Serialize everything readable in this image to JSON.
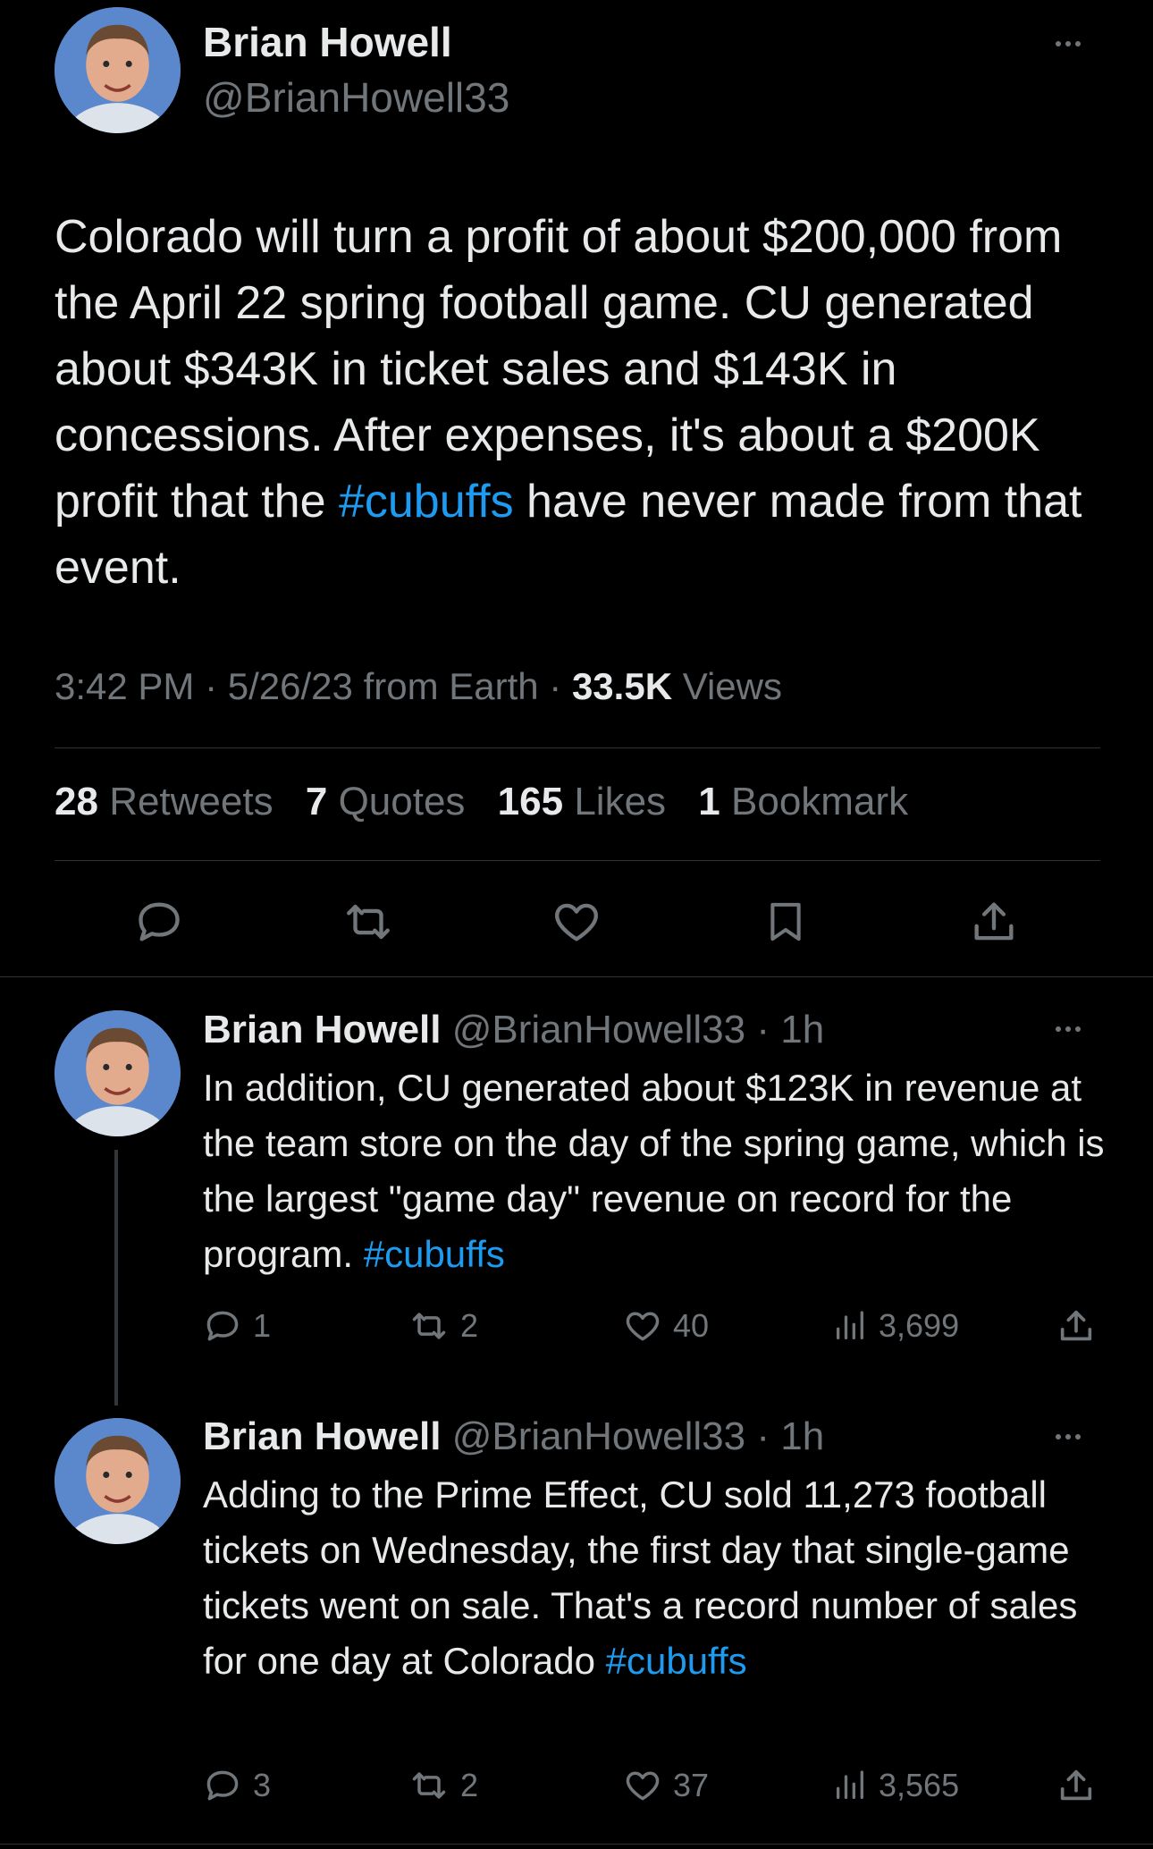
{
  "main_tweet": {
    "author_name": "Brian Howell",
    "author_handle": "@BrianHowell33",
    "text_before_tag": "Colorado will turn a profit of about $200,000 from the April 22 spring football game. CU generated about $343K in ticket sales and $143K in concessions. After expenses, it's about a $200K profit that the ",
    "hashtag": "#cubuffs",
    "text_after_tag": " have never made from that event.",
    "time": "3:42 PM",
    "date": "5/26/23",
    "source": "from Earth",
    "views_count": "33.5K",
    "views_label": "Views",
    "stats": {
      "retweets_count": "28",
      "retweets_label": "Retweets",
      "quotes_count": "7",
      "quotes_label": "Quotes",
      "likes_count": "165",
      "likes_label": "Likes",
      "bookmarks_count": "1",
      "bookmarks_label": "Bookmark"
    }
  },
  "replies": [
    {
      "author_name": "Brian Howell",
      "author_handle": "@BrianHowell33",
      "time_ago": "1h",
      "text_before_tag": "In addition, CU generated about $123K in revenue at the team store on the day of the spring game, which is the largest \"game day\" revenue on record for the program. ",
      "hashtag": "#cubuffs",
      "replies": "1",
      "retweets": "2",
      "likes": "40",
      "views": "3,699"
    },
    {
      "author_name": "Brian Howell",
      "author_handle": "@BrianHowell33",
      "time_ago": "1h",
      "text_before_tag": "Adding to the Prime Effect, CU sold 11,273 football tickets on Wednesday, the first day that single-game tickets went on sale. That's a record number of sales for one day at Colorado ",
      "hashtag": "#cubuffs",
      "replies": "3",
      "retweets": "2",
      "likes": "37",
      "views": "3,565"
    }
  ],
  "icons": {
    "reply": "reply-icon",
    "retweet": "retweet-icon",
    "like": "heart-icon",
    "bookmark": "bookmark-icon",
    "share": "share-icon",
    "views": "views-icon",
    "more": "more-icon"
  },
  "colors": {
    "background": "#000000",
    "text": "#e7e9ea",
    "muted": "#71767b",
    "link": "#1d9bf0",
    "divider": "#2f3336"
  }
}
